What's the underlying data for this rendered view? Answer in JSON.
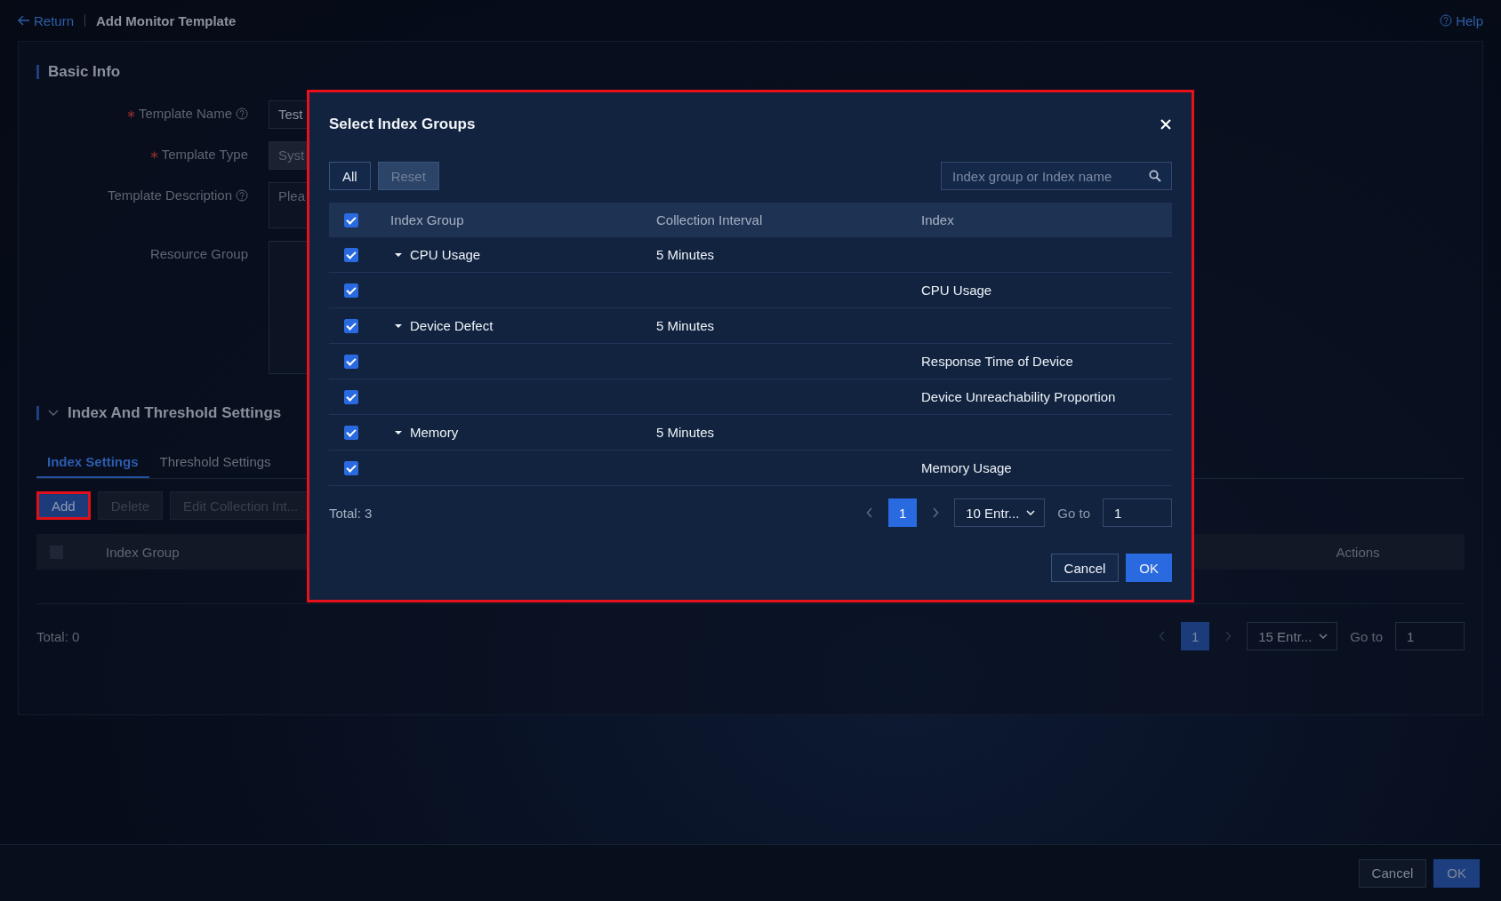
{
  "header": {
    "back_link": "Return",
    "title": "Add Monitor Template",
    "help": "Help"
  },
  "basic_info": {
    "title": "Basic Info",
    "fields": [
      {
        "kind": "input",
        "label": "Template Name",
        "required": true,
        "help": true,
        "value": "Test",
        "disabled": false
      },
      {
        "kind": "input",
        "label": "Template Type",
        "required": true,
        "help": false,
        "value": "Syst",
        "disabled": true
      },
      {
        "kind": "textarea",
        "label": "Template Description",
        "required": false,
        "help": true,
        "placeholder": "Plea"
      },
      {
        "kind": "box",
        "label": "Resource Group",
        "required": false,
        "help": false
      }
    ]
  },
  "index_section": {
    "title": "Index And Threshold Settings",
    "expanded": true,
    "tabs": [
      {
        "label": "Index Settings",
        "selected": true
      },
      {
        "label": "Threshold Settings",
        "selected": false
      }
    ],
    "buttons": [
      {
        "label": "Add",
        "disabled": false,
        "highlighted": true
      },
      {
        "label": "Delete",
        "disabled": true,
        "highlighted": false
      },
      {
        "label": "Edit Collection Int...",
        "disabled": true,
        "highlighted": false
      }
    ],
    "table": {
      "checked": false,
      "columns": [
        "Index Group",
        "Actions"
      ]
    },
    "total": "Total: 0",
    "pagination": {
      "pages": [
        {
          "label": "1",
          "selected": true
        }
      ],
      "page_size": "15 Entr...",
      "goto_label": "Go to",
      "goto_value": "1"
    }
  },
  "footer": {
    "buttons": [
      {
        "label": "Cancel",
        "primary": false
      },
      {
        "label": "OK",
        "primary": true
      }
    ]
  },
  "modal": {
    "title": "Select Index Groups",
    "highlighted": true,
    "filters": [
      {
        "label": "All",
        "disabled": false
      },
      {
        "label": "Reset",
        "disabled": true
      }
    ],
    "search": {
      "placeholder": "Index group or Index name"
    },
    "columns": [
      "Index Group",
      "Collection Interval",
      "Index"
    ],
    "all_checked": true,
    "groups": [
      {
        "name": "CPU Usage",
        "interval": "5 Minutes",
        "checked": true,
        "expanded": true,
        "children": [
          {
            "index": "CPU Usage",
            "checked": true
          }
        ]
      },
      {
        "name": "Device Defect",
        "interval": "5 Minutes",
        "checked": true,
        "expanded": true,
        "children": [
          {
            "index": "Response Time of Device",
            "checked": true
          },
          {
            "index": "Device Unreachability Proportion",
            "checked": true
          }
        ]
      },
      {
        "name": "Memory",
        "interval": "5 Minutes",
        "checked": true,
        "expanded": true,
        "children": [
          {
            "index": "Memory Usage",
            "checked": true
          }
        ]
      }
    ],
    "total": "Total: 3",
    "pagination": {
      "pages": [
        {
          "label": "1",
          "selected": true
        }
      ],
      "page_size": "10 Entr...",
      "goto_label": "Go to",
      "goto_value": "1"
    },
    "buttons": [
      {
        "label": "Cancel",
        "primary": false
      },
      {
        "label": "OK",
        "primary": true
      }
    ]
  }
}
